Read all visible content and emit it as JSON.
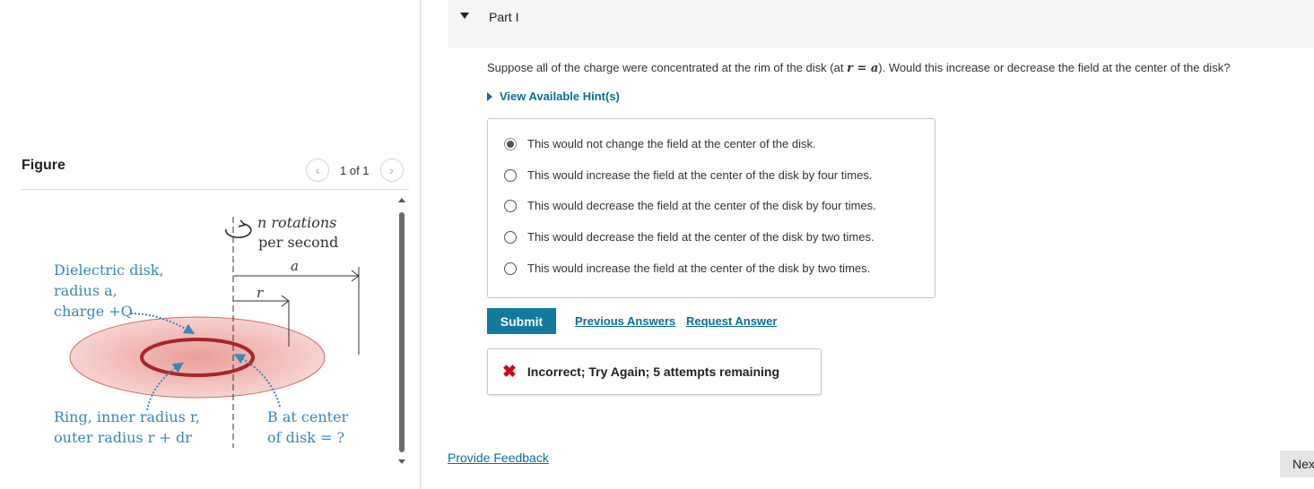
{
  "figure": {
    "title": "Figure",
    "pager_text": "1 of 1",
    "diagram": {
      "rotation_line1": "n rotations",
      "rotation_line2": "per second",
      "label_a": "a",
      "label_r": "r",
      "disk_line1": "Dielectric disk,",
      "disk_line2": "radius a,",
      "disk_line3": "charge +Q",
      "ring_line1": "Ring, inner radius r,",
      "ring_line2": "outer radius r + dr",
      "b_line1": "B at center",
      "b_line2": "of disk = ?",
      "colors": {
        "label_blue": "#3a87b8",
        "disk_fill": "#f3b9b5",
        "ring_stroke": "#a7262a"
      }
    }
  },
  "part": {
    "label": "Part I"
  },
  "question": {
    "text_before": "Suppose all of the charge were concentrated at the rim of the disk (at ",
    "math": "r = a",
    "text_after": "). Would this increase or decrease the field at the center of the disk?"
  },
  "hint": {
    "label": "View Available Hint(s)"
  },
  "choices": [
    {
      "label": "This would not change the field at the center of the disk.",
      "selected": true
    },
    {
      "label": "This would increase the field at the center of the disk by four times.",
      "selected": false
    },
    {
      "label": "This would decrease the field at the center of the disk by four times.",
      "selected": false
    },
    {
      "label": "This would decrease the field at the center of the disk by two times.",
      "selected": false
    },
    {
      "label": "This would increase the field at the center of the disk by two times.",
      "selected": false
    }
  ],
  "actions": {
    "submit": "Submit",
    "previous_answers": "Previous Answers",
    "request_answer": "Request Answer"
  },
  "feedback": {
    "icon": "x-icon",
    "message": "Incorrect; Try Again; 5 attempts remaining",
    "color": "#d0021b"
  },
  "footer": {
    "provide_feedback": "Provide Feedback",
    "next": "Next"
  },
  "colors": {
    "accent": "#127a9e",
    "link": "#0a6e9e"
  }
}
